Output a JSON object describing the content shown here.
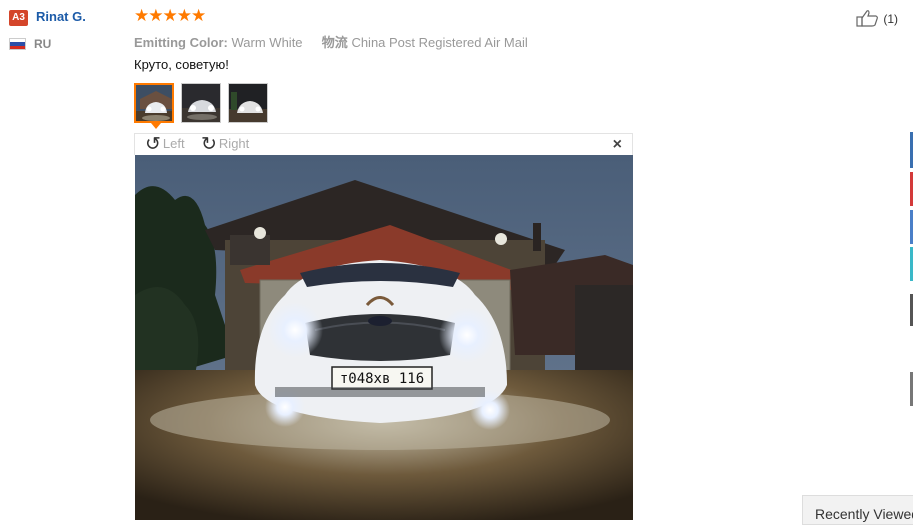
{
  "review": {
    "user_badge": "A3",
    "user_name": "Rinat G.",
    "country": "RU",
    "stars": "★★★★★",
    "rating": 5,
    "attributes": [
      {
        "key": "Emitting Color:",
        "value": "Warm White"
      },
      {
        "key": "物流",
        "value": "China Post Registered Air Mail"
      }
    ],
    "comment": "Круто, советую!",
    "like_count": "(1)"
  },
  "viewer": {
    "rotate_left_label": "Left",
    "rotate_right_label": "Right",
    "close_symbol": "×",
    "plate_text": "т048хв 116"
  },
  "sidebar": {
    "recently_viewed_label": "Recently Viewed"
  },
  "colors": {
    "accent": "#ff7a00",
    "link": "#1c5ba8",
    "badge": "#d4452a"
  },
  "icons": [
    "thumbs-up-icon",
    "rotate-left-icon",
    "rotate-right-icon",
    "close-icon",
    "flag-ru-icon"
  ]
}
